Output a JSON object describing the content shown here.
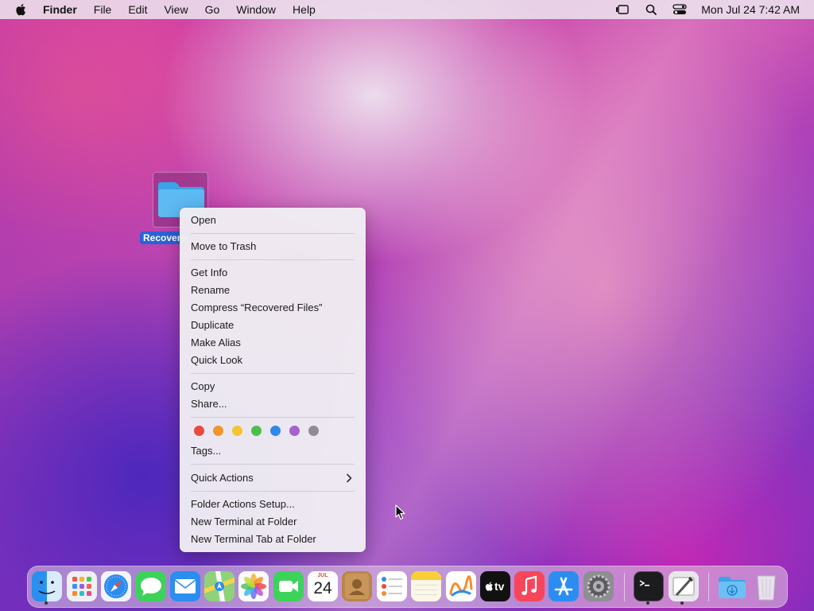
{
  "menubar": {
    "app_name": "Finder",
    "menus": [
      "File",
      "Edit",
      "View",
      "Go",
      "Window",
      "Help"
    ],
    "clock": "Mon Jul 24  7:42 AM"
  },
  "desktop": {
    "folder_label": "Recovered Files"
  },
  "context_menu": {
    "open": "Open",
    "move_to_trash": "Move to Trash",
    "get_info": "Get Info",
    "rename": "Rename",
    "compress": "Compress “Recovered Files”",
    "duplicate": "Duplicate",
    "make_alias": "Make Alias",
    "quick_look": "Quick Look",
    "copy": "Copy",
    "share": "Share...",
    "tag_colors": [
      "#e94a3f",
      "#f0962c",
      "#f4c431",
      "#4cbf4a",
      "#2f88ec",
      "#a561d0",
      "#8e8e92"
    ],
    "tags": "Tags...",
    "quick_actions": "Quick Actions",
    "folder_actions_setup": "Folder Actions Setup...",
    "new_terminal_at_folder": "New Terminal at Folder",
    "new_terminal_tab_at_folder": "New Terminal Tab at Folder"
  },
  "dock": {
    "calendar_month": "JUL",
    "calendar_day": "24",
    "tv_label": "tv"
  }
}
